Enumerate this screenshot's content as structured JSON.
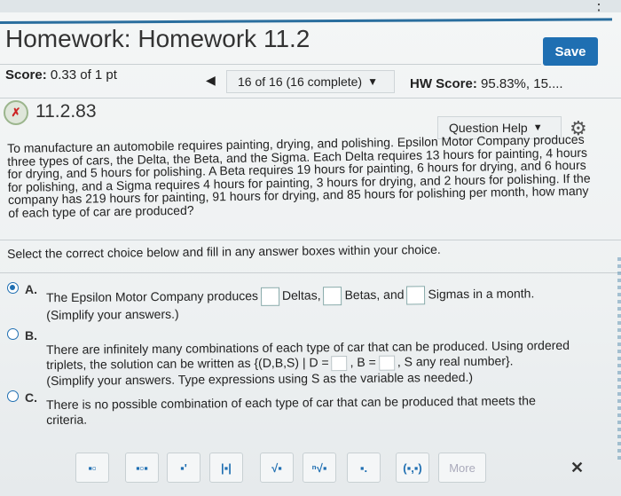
{
  "header": {
    "title": "Homework: Homework 11.2",
    "save_label": "Save"
  },
  "scorebar": {
    "score_label": "Score:",
    "score_value": "0.33 of 1 pt",
    "prev_arrow": "◀",
    "progress": "16 of 16 (16 complete)",
    "hw_label": "HW Score:",
    "hw_value": "95.83%, 15...."
  },
  "question": {
    "number": "11.2.83",
    "help_label": "Question Help",
    "text": "To manufacture an automobile requires painting, drying, and polishing. Epsilon Motor Company produces three types of cars, the Delta, the Beta, and the Sigma. Each Delta requires 13 hours for painting, 4 hours for drying, and 5 hours for polishing. A Beta requires 19 hours for painting, 6 hours for drying, and 6 hours for polishing, and a Sigma requires 4 hours for painting, 3 hours for drying, and 2 hours for polishing. If the company has 219 hours for painting, 91 hours for drying, and 85 hours for polishing per month, how many of each type of car are produced?",
    "instruction": "Select the correct choice below and fill in any answer boxes within your choice."
  },
  "choices": {
    "a": {
      "letter": "A.",
      "t1": "The Epsilon Motor Company produces",
      "t2": "Deltas,",
      "t3": "Betas, and",
      "t4": "Sigmas in a month.",
      "t5": "(Simplify your answers.)"
    },
    "b": {
      "letter": "B.",
      "t1": "There are infinitely many combinations of each type of car that can be produced. Using ordered",
      "t2": "triplets, the solution can be written as {(D,B,S) | D =",
      "t3": ", B =",
      "t4": ", S any real number}.",
      "t5": "(Simplify your answers. Type expressions using S as the variable as needed.)"
    },
    "c": {
      "letter": "C.",
      "t1": "There is no possible combination of each type of car that can be produced that meets the",
      "t2": "criteria."
    }
  },
  "toolbar": {
    "buttons": [
      "▪▫",
      "▪▫▪",
      "▪'",
      "|▪|",
      "√▪",
      "ⁿ√▪",
      "▪.",
      "(▪,▪)"
    ],
    "more_label": "More",
    "close": "✕"
  },
  "colors": {
    "accent": "#1f6fb2",
    "topline": "#2a6e9e"
  }
}
